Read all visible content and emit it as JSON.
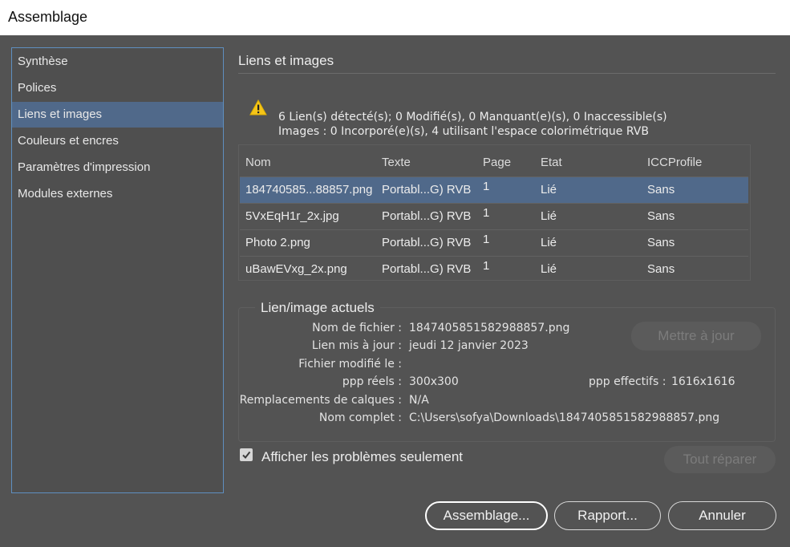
{
  "window": {
    "title": "Assemblage"
  },
  "sidebar": {
    "items": [
      {
        "label": "Synthèse"
      },
      {
        "label": "Polices"
      },
      {
        "label": "Liens et images",
        "selected": true
      },
      {
        "label": "Couleurs et encres"
      },
      {
        "label": "Paramètres d'impression"
      },
      {
        "label": "Modules externes"
      }
    ]
  },
  "main": {
    "section_title": "Liens et images",
    "warning": {
      "icon": "warning-triangle-icon",
      "line1": "6 Lien(s) détecté(s); 0 Modifié(s), 0 Manquant(e)(s), 0 Inaccessible(s)",
      "line2": "Images : 0 Incorporé(e)(s), 4 utilisant l'espace colorimétrique RVB"
    },
    "table": {
      "headers": [
        "Nom",
        "Texte",
        "Page",
        "Etat",
        "ICCProfile"
      ],
      "rows": [
        {
          "nom": "184740585...88857.png",
          "texte": "Portabl...G) RVB",
          "page": "1",
          "etat": "Lié",
          "icc": "Sans",
          "selected": true
        },
        {
          "nom": "5VxEqH1r_2x.jpg",
          "texte": "Portabl...G) RVB",
          "page": "1",
          "etat": "Lié",
          "icc": "Sans"
        },
        {
          "nom": "Photo 2.png",
          "texte": "Portabl...G) RVB",
          "page": "1",
          "etat": "Lié",
          "icc": "Sans"
        },
        {
          "nom": "uBawEVxg_2x.png",
          "texte": "Portabl...G) RVB",
          "page": "1",
          "etat": "Lié",
          "icc": "Sans"
        }
      ]
    },
    "details": {
      "title": "Lien/image actuels",
      "filename_label": "Nom de fichier :",
      "filename": "1847405851582988857.png",
      "link_updated_label": "Lien mis à jour :",
      "link_updated": "jeudi 12 janvier 2023",
      "file_modified_label": "Fichier modifié le :",
      "file_modified": "",
      "ppi_actual_label": "ppp réels :",
      "ppi_actual": "300x300",
      "ppi_effective_label": "ppp effectifs :",
      "ppi_effective": "1616x1616",
      "layer_overrides_label": "Remplacements de calques :",
      "layer_overrides": "N/A",
      "full_name_label": "Nom complet :",
      "full_name": "C:\\Users\\sofya\\Downloads\\1847405851582988857.png",
      "update_button": "Mettre à jour"
    },
    "show_problems_only": {
      "label": "Afficher les problèmes seulement",
      "checked": true
    },
    "repair_all_button": "Tout réparer"
  },
  "footer": {
    "package_button": "Assemblage...",
    "report_button": "Rapport...",
    "cancel_button": "Annuler"
  },
  "colors": {
    "background": "#535353",
    "selection": "#50698a",
    "sidebar_border": "#5f8fc0",
    "warning": "#f5c518"
  }
}
